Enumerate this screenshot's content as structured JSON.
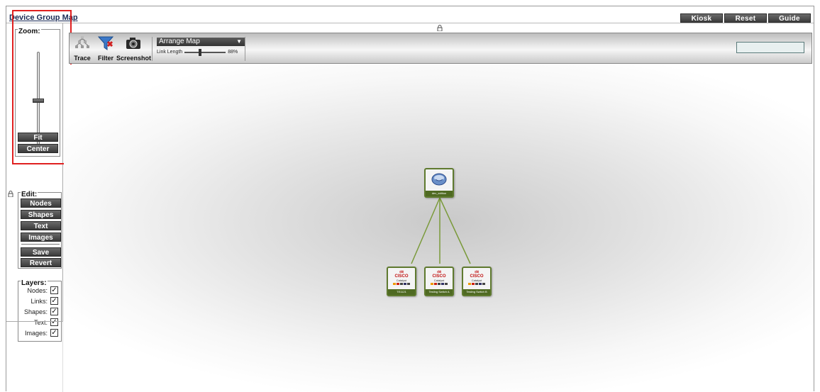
{
  "window": {
    "title": "Device Group Map"
  },
  "top_buttons": {
    "kiosk": "Kiosk",
    "reset": "Reset",
    "guide": "Guide"
  },
  "zoom": {
    "label": "Zoom:",
    "fit": "Fit",
    "center": "Center"
  },
  "edit": {
    "label": "Edit:",
    "nodes": "Nodes",
    "shapes": "Shapes",
    "text": "Text",
    "images": "Images",
    "save": "Save",
    "revert": "Revert"
  },
  "layers": {
    "label": "Layers:",
    "items": [
      {
        "label": "Nodes:",
        "checked": "✓"
      },
      {
        "label": "Links:",
        "checked": "✓"
      },
      {
        "label": "Shapes:",
        "checked": "✓"
      },
      {
        "label": "Text:",
        "checked": "✓"
      },
      {
        "label": "Images:",
        "checked": "✓"
      }
    ]
  },
  "toolbar": {
    "trace": "Trace",
    "filter": "Filter",
    "screenshot": "Screenshot",
    "arrange": "Arrange Map",
    "link_length_label": "Link Length",
    "link_length_value": "88%",
    "search_value": ""
  },
  "map": {
    "center_node": {
      "label": "dev_edition"
    },
    "child_nodes": [
      {
        "brand": "CISCO",
        "model": "Catalyst",
        "label": "TE1121"
      },
      {
        "brand": "CISCO",
        "model": "Catalyst",
        "label": "Testing Switch A"
      },
      {
        "brand": "CISCO",
        "model": "Catalyst",
        "label": "Testing Switch B"
      }
    ],
    "colors": {
      "node_border": "#5f7a2f",
      "link": "#7a9a3a",
      "zoom_highlight": "#e02020"
    }
  }
}
